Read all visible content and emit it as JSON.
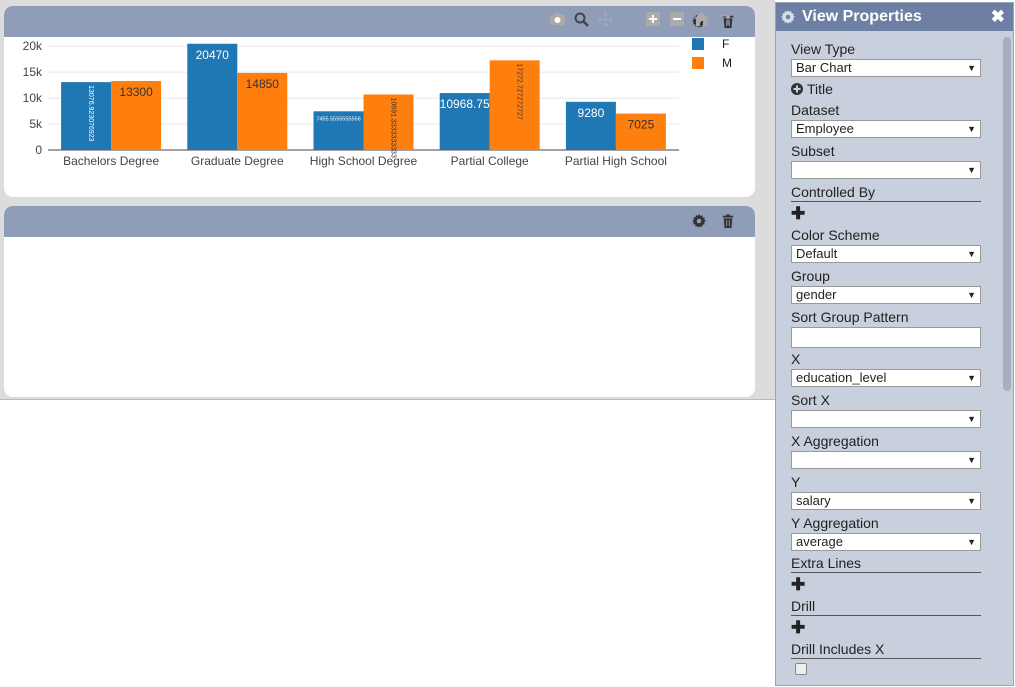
{
  "chart_data": {
    "type": "bar",
    "categories": [
      "Bachelors Degree",
      "Graduate Degree",
      "High School Degree",
      "Partial College",
      "Partial High School"
    ],
    "series": [
      {
        "name": "F",
        "color": "#1f77b4",
        "values": [
          13076.923076923,
          20470,
          7455.5555555556,
          10968.75,
          9280
        ],
        "labels": [
          "13076.923076923",
          "20470",
          "7455.5555555556",
          "10968.75",
          "9280"
        ]
      },
      {
        "name": "M",
        "color": "#ff7f0e",
        "values": [
          13300,
          14850,
          10691.3333333333,
          17272.727272727,
          7025
        ],
        "labels": [
          "13300",
          "14850",
          "10691.3333333333",
          "17272.727272727",
          "7025"
        ]
      }
    ],
    "ylim": [
      0,
      21000
    ],
    "yticks": [
      "0",
      "5k",
      "10k",
      "15k",
      "20k"
    ],
    "ytick_values": [
      0,
      5000,
      10000,
      15000,
      20000
    ],
    "grid": true,
    "legend_position": "top-right"
  },
  "toolbar": [
    "camera-icon",
    "zoom-icon",
    "pan-icon",
    "zoom-in-icon",
    "zoom-out-icon",
    "home-icon",
    "spike-icon"
  ],
  "props": {
    "title": "View Properties",
    "close": "✖",
    "fields": {
      "view_type": {
        "label": "View Type",
        "value": "Bar Chart"
      },
      "title": {
        "label": "Title"
      },
      "dataset": {
        "label": "Dataset",
        "value": "Employee"
      },
      "subset": {
        "label": "Subset",
        "value": ""
      },
      "controlled_by": {
        "label": "Controlled By"
      },
      "color_scheme": {
        "label": "Color Scheme",
        "value": "Default"
      },
      "group": {
        "label": "Group",
        "value": "gender"
      },
      "sort_group_pattern": {
        "label": "Sort Group Pattern",
        "value": ""
      },
      "x": {
        "label": "X",
        "value": "education_level"
      },
      "sort_x": {
        "label": "Sort X",
        "value": ""
      },
      "x_aggregation": {
        "label": "X Aggregation",
        "value": ""
      },
      "y": {
        "label": "Y",
        "value": "salary"
      },
      "y_aggregation": {
        "label": "Y Aggregation",
        "value": "average"
      },
      "extra_lines": {
        "label": "Extra Lines"
      },
      "drill": {
        "label": "Drill"
      },
      "drill_includes_x": {
        "label": "Drill Includes X"
      }
    }
  }
}
